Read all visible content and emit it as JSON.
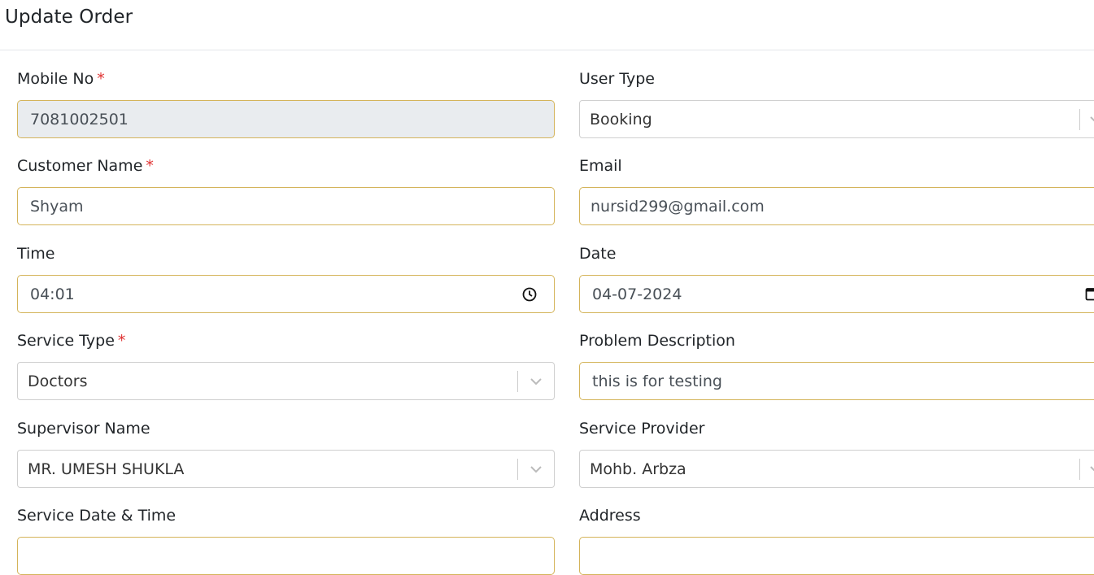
{
  "page": {
    "title": "Update Order"
  },
  "form": {
    "mobile_no": {
      "label": "Mobile No",
      "required_mark": "*",
      "value": "7081002501"
    },
    "user_type": {
      "label": "User Type",
      "value": "Booking"
    },
    "customer_name": {
      "label": "Customer Name",
      "required_mark": "*",
      "value": "Shyam"
    },
    "email": {
      "label": "Email",
      "value": "nursid299@gmail.com"
    },
    "time": {
      "label": "Time",
      "value": "04:01",
      "icon": "clock-icon"
    },
    "date": {
      "label": "Date",
      "value": "04-07-2024",
      "icon": "calendar-icon"
    },
    "service_type": {
      "label": "Service Type",
      "required_mark": "*",
      "value": "Doctors"
    },
    "problem_description": {
      "label": "Problem Description",
      "value": "this is for testing"
    },
    "supervisor_name": {
      "label": "Supervisor Name",
      "value": "MR. UMESH SHUKLA"
    },
    "service_provider": {
      "label": "Service Provider",
      "value": "Mohb. Arbza"
    },
    "service_date_time": {
      "label": "Service Date & Time",
      "value": ""
    },
    "address": {
      "label": "Address",
      "value": ""
    }
  },
  "colors": {
    "input_border": "#d4b45a",
    "select_border": "#cfcfcf",
    "required": "#e03131",
    "disabled_bg": "#e9ecef"
  }
}
